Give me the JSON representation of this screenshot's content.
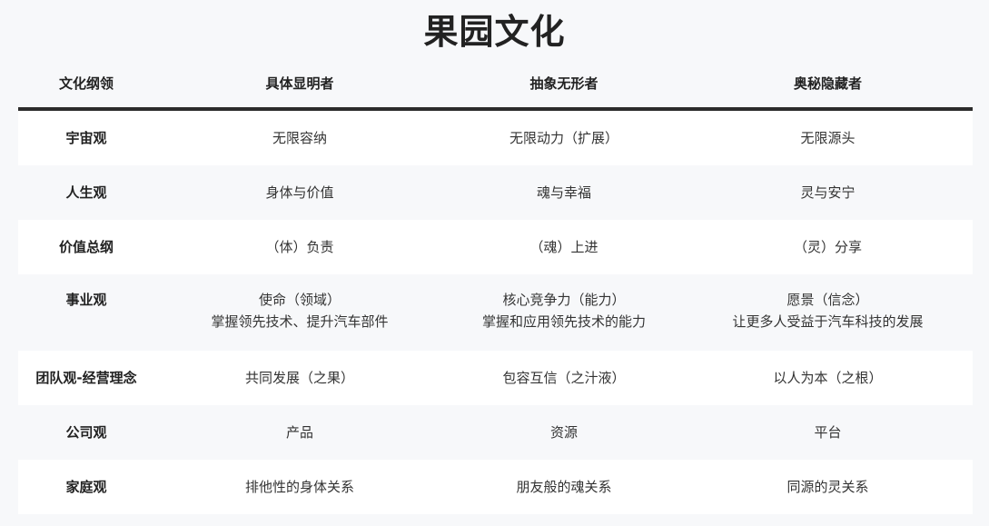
{
  "title": "果园文化",
  "table": {
    "headers": [
      "文化纲领",
      "具体显明者",
      "抽象无形者",
      "奥秘隐藏者"
    ],
    "rows": [
      {
        "label": "宇宙观",
        "col1": [
          "无限容纳"
        ],
        "col2": [
          "无限动力（扩展）"
        ],
        "col3": [
          "无限源头"
        ]
      },
      {
        "label": "人生观",
        "col1": [
          "身体与价值"
        ],
        "col2": [
          "魂与幸福"
        ],
        "col3": [
          "灵与安宁"
        ]
      },
      {
        "label": "价值总纲",
        "col1": [
          "（体）负责"
        ],
        "col2": [
          "（魂）上进"
        ],
        "col3": [
          "（灵）分享"
        ]
      },
      {
        "label": "事业观",
        "col1": [
          "使命（领域）",
          "掌握领先技术、提升汽车部件"
        ],
        "col2": [
          "核心竞争力（能力）",
          "掌握和应用领先技术的能力"
        ],
        "col3": [
          "愿景（信念）",
          "让更多人受益于汽车科技的发展"
        ]
      },
      {
        "label": "团队观-经营理念",
        "col1": [
          "共同发展（之果）"
        ],
        "col2": [
          "包容互信（之汁液）"
        ],
        "col3": [
          "以人为本（之根）"
        ]
      },
      {
        "label": "公司观",
        "col1": [
          "产品"
        ],
        "col2": [
          "资源"
        ],
        "col3": [
          "平台"
        ]
      },
      {
        "label": "家庭观",
        "col1": [
          "排他性的身体关系"
        ],
        "col2": [
          "朋友般的魂关系"
        ],
        "col3": [
          "同源的灵关系"
        ]
      }
    ]
  }
}
